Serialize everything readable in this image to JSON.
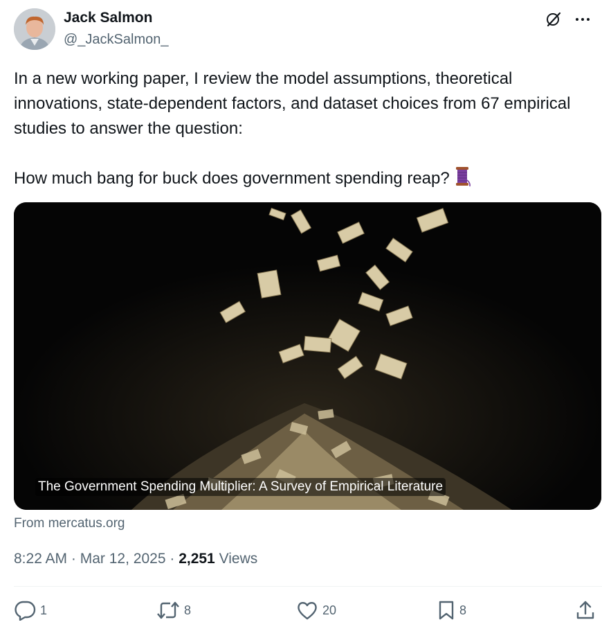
{
  "author": {
    "name": "Jack Salmon",
    "handle": "@_JackSalmon_"
  },
  "tweet": {
    "text": "In a new working paper, I review the model assumptions, theoretical innovations, state-dependent factors, and dataset choices from 67 empirical studies to answer the question:\n\nHow much bang for buck does government spending reap?"
  },
  "card": {
    "title": "The Government Spending Multiplier: A Survey of Empirical Literature",
    "source": "From mercatus.org"
  },
  "meta": {
    "time": "8:22 AM",
    "sep": "·",
    "date": "Mar 12, 2025",
    "views_count": "2,251",
    "views_label": "Views"
  },
  "actions": {
    "replies": "1",
    "reposts": "8",
    "likes": "20",
    "bookmarks": "8"
  },
  "icons": [
    "grok-icon",
    "more-icon",
    "thread-emoji-icon",
    "reply-icon",
    "repost-icon",
    "like-icon",
    "bookmark-icon",
    "share-icon"
  ],
  "colors": {
    "text": "#0f1419",
    "secondary": "#536471",
    "divider": "#eff3f4"
  }
}
